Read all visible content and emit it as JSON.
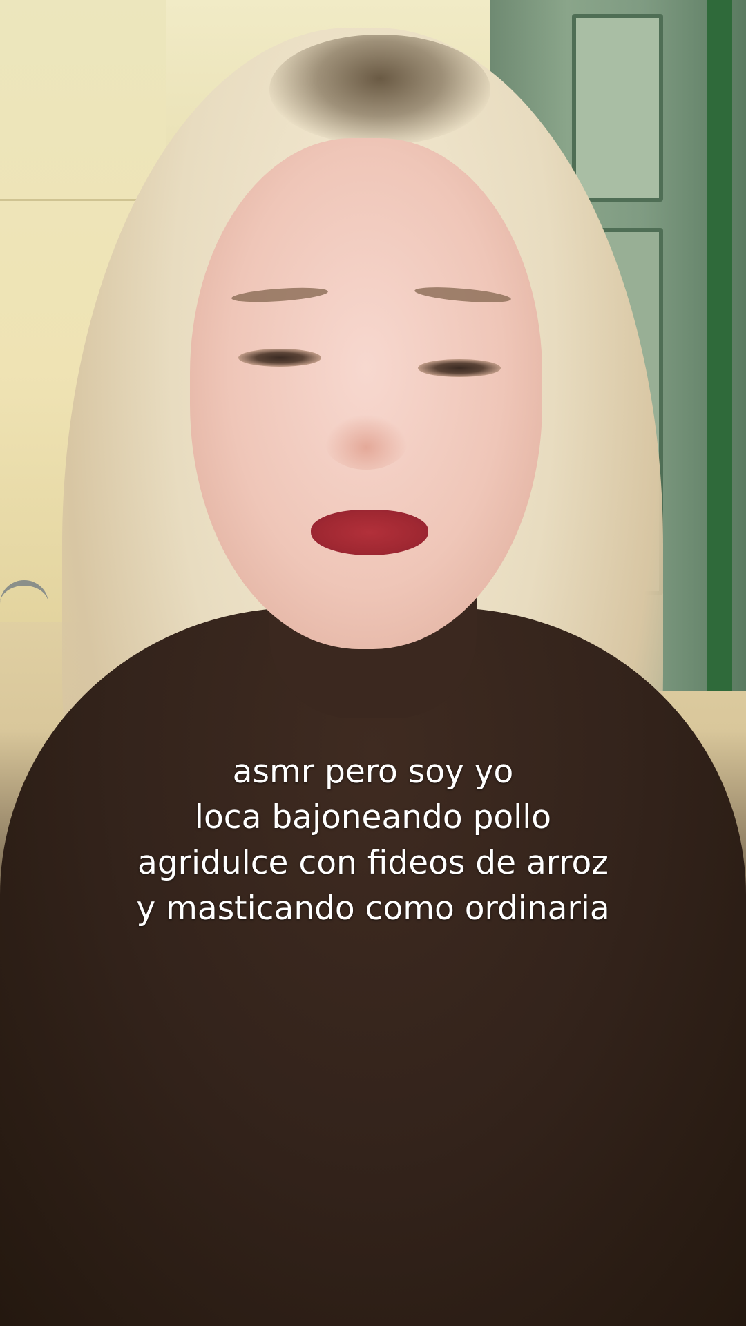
{
  "caption": {
    "lines": [
      "asmr pero soy yo",
      "loca bajoneando pollo",
      "agridulce con fideos de arroz",
      "y masticando como ordinaria"
    ]
  }
}
